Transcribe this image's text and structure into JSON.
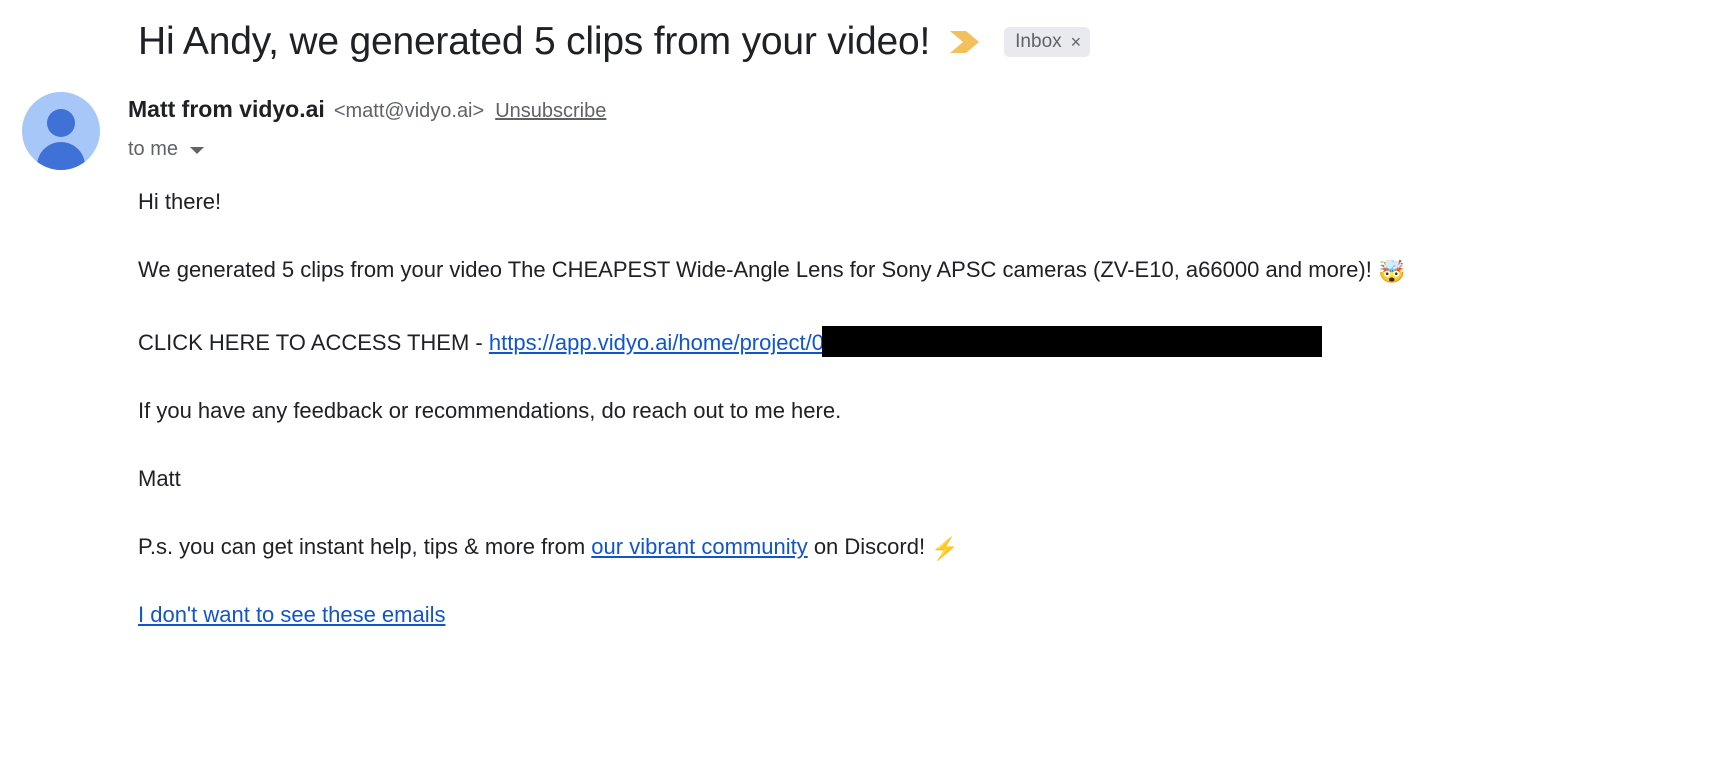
{
  "subject": {
    "text": "Hi Andy, we generated 5 clips from your video!",
    "important_marker_icon": "important-chevron-icon",
    "label": "Inbox",
    "label_close": "×"
  },
  "sender": {
    "avatar_icon": "person-avatar-icon",
    "name": "Matt from vidyo.ai",
    "email": "<matt@vidyo.ai>",
    "unsubscribe_label": "Unsubscribe",
    "recipient": "to me",
    "recipient_caret_icon": "chevron-down-icon"
  },
  "body": {
    "greeting": "Hi there!",
    "intro_before": "We generated 5 clips from your video The CHEAPEST Wide-Angle Lens for Sony APSC cameras (ZV-E10, a66000 and more)!",
    "intro_emoji": "🤯",
    "cta_prefix": "CLICK HERE TO ACCESS THEM - ",
    "cta_link": "https://app.vidyo.ai/home/project/0b",
    "feedback": "If you have any feedback or recommendations, do reach out to me here.",
    "signature": "Matt",
    "ps_prefix": "P.s. you can get instant help, tips & more from ",
    "ps_link": "our vibrant community",
    "ps_suffix": " on Discord! ",
    "ps_emoji": "⚡",
    "footer_link": "I don't want to see these emails"
  },
  "colors": {
    "link": "#1155cc",
    "important_marker": "#f2c15c",
    "label_chip_bg": "#e8eaed",
    "avatar_bg": "#a6c7f7",
    "avatar_fg": "#4071d6",
    "text": "#202124",
    "muted_text": "#5f6368",
    "redaction": "#000000"
  }
}
